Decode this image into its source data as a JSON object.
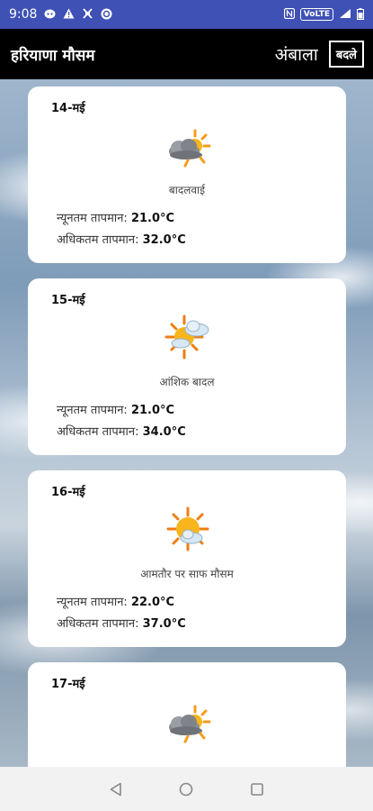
{
  "status_bar": {
    "time": "9:08",
    "left_icons": [
      "discord-icon",
      "warning-icon",
      "muted-icon",
      "vpn-icon"
    ],
    "right_icons": [
      "nfc-icon",
      "volte-icon",
      "signal-icon",
      "battery-icon"
    ],
    "volte": "VoLTE"
  },
  "app_bar": {
    "title": "हरियाणा मौसम",
    "city": "अंबाला",
    "change_label": "बदले"
  },
  "cards": [
    {
      "date": "14-मई",
      "icon": "cloudy-icon",
      "description": "बादलवाई",
      "min_label": "न्यूनतम तापमान:",
      "min_value": "21.0°C",
      "max_label": "अधिकतम तापमान:",
      "max_value": "32.0°C"
    },
    {
      "date": "15-मई",
      "icon": "partly-cloudy-icon",
      "description": "आंशिक बादल",
      "min_label": "न्यूनतम तापमान:",
      "min_value": "21.0°C",
      "max_label": "अधिकतम तापमान:",
      "max_value": "34.0°C"
    },
    {
      "date": "16-मई",
      "icon": "mostly-sunny-icon",
      "description": "आमतौर पर साफ मौसम",
      "min_label": "न्यूनतम तापमान:",
      "min_value": "22.0°C",
      "max_label": "अधिकतम तापमान:",
      "max_value": "37.0°C"
    },
    {
      "date": "17-मई",
      "icon": "cloudy-icon"
    }
  ],
  "nav_bar": {
    "buttons": [
      "back-button",
      "home-button",
      "recents-button"
    ]
  }
}
